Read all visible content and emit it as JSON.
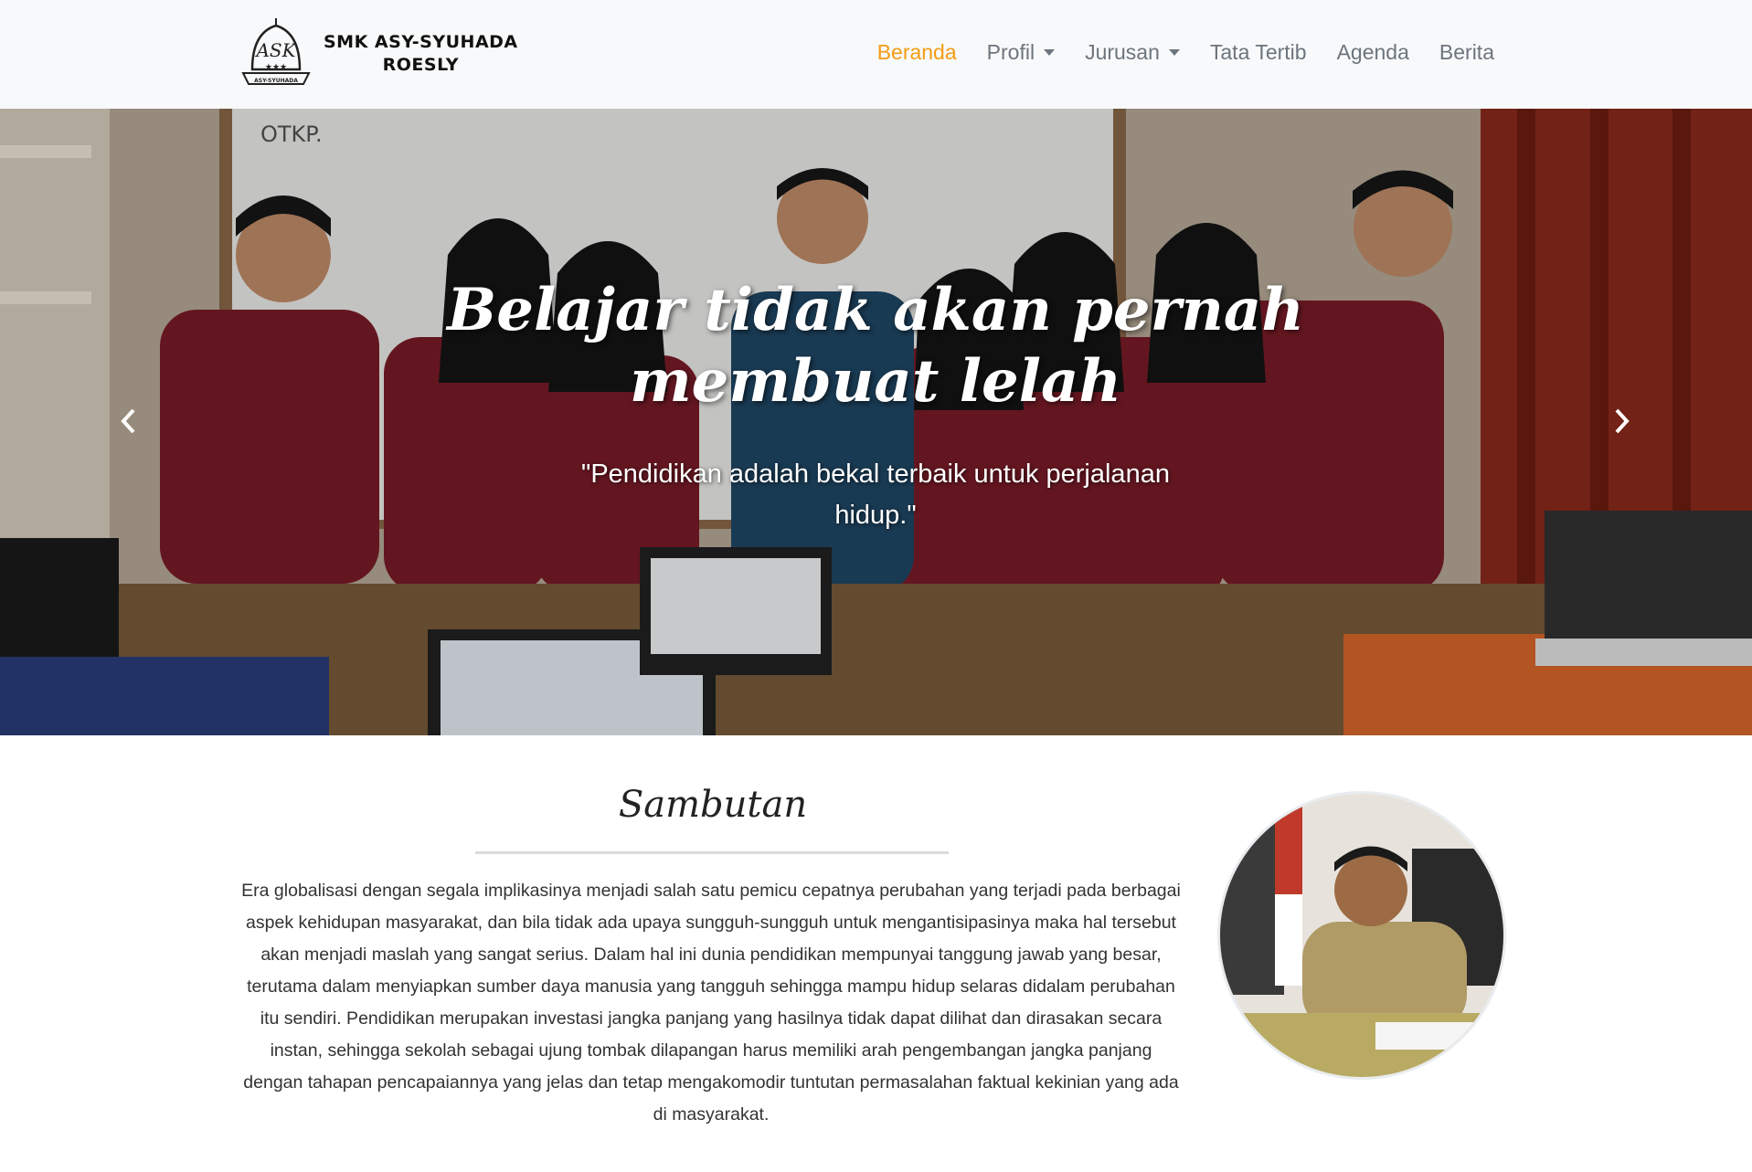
{
  "brand": {
    "name_line1": "SMK ASY-SYUHADA",
    "name_line2": "ROESLY",
    "logo_text": "ASY-SYUHADA"
  },
  "nav": {
    "items": [
      {
        "label": "Beranda",
        "active": true,
        "dropdown": false
      },
      {
        "label": "Profil",
        "active": false,
        "dropdown": true
      },
      {
        "label": "Jurusan",
        "active": false,
        "dropdown": true
      },
      {
        "label": "Tata Tertib",
        "active": false,
        "dropdown": false
      },
      {
        "label": "Agenda",
        "active": false,
        "dropdown": false
      },
      {
        "label": "Berita",
        "active": false,
        "dropdown": false
      }
    ],
    "active_color": "#f39c12",
    "text_color": "#6c757d"
  },
  "hero": {
    "title": "Belajar tidak akan pernah membuat lelah",
    "subtitle": "\"Pendidikan adalah bekal terbaik untuk perjalanan hidup.\"",
    "board_text": "OTKP.",
    "prev_icon": "chevron-left-icon",
    "next_icon": "chevron-right-icon"
  },
  "sambutan": {
    "title": "Sambutan",
    "body": "Era globalisasi dengan segala implikasinya menjadi salah satu pemicu cepatnya perubahan yang terjadi pada berbagai aspek kehidupan masyarakat, dan bila tidak ada upaya sungguh-sungguh untuk mengantisipasinya maka hal tersebut akan menjadi maslah yang sangat serius. Dalam hal ini dunia pendidikan mempunyai tanggung jawab yang besar, terutama dalam menyiapkan sumber daya manusia yang tangguh sehingga mampu hidup selaras didalam perubahan itu sendiri. Pendidikan merupakan investasi jangka panjang yang hasilnya tidak dapat dilihat dan dirasakan secara instan, sehingga sekolah sebagai ujung tombak dilapangan harus memiliki arah pengembangan jangka panjang dengan tahapan pencapaiannya yang jelas dan tetap mengakomodir tuntutan permasalahan faktual kekinian yang ada di masyarakat."
  }
}
